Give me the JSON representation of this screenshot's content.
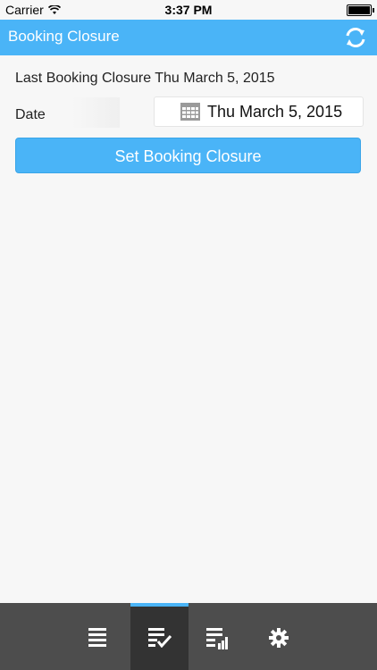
{
  "status_bar": {
    "carrier": "Carrier",
    "time": "3:37 PM"
  },
  "header": {
    "title": "Booking Closure",
    "refresh_icon": "refresh-icon"
  },
  "content": {
    "last_closure_text": "Last Booking Closure Thu March 5, 2015",
    "date_label": "Date",
    "date_value": "Thu March 5, 2015",
    "set_button_label": "Set Booking Closure"
  },
  "tabs": [
    {
      "icon": "list-icon",
      "active": false
    },
    {
      "icon": "checklist-icon",
      "active": true
    },
    {
      "icon": "report-chart-icon",
      "active": false
    },
    {
      "icon": "gear-icon",
      "active": false
    }
  ],
  "colors": {
    "accent": "#4ab4f7",
    "tab_bar": "#4d4d4d",
    "tab_active": "#333333"
  }
}
